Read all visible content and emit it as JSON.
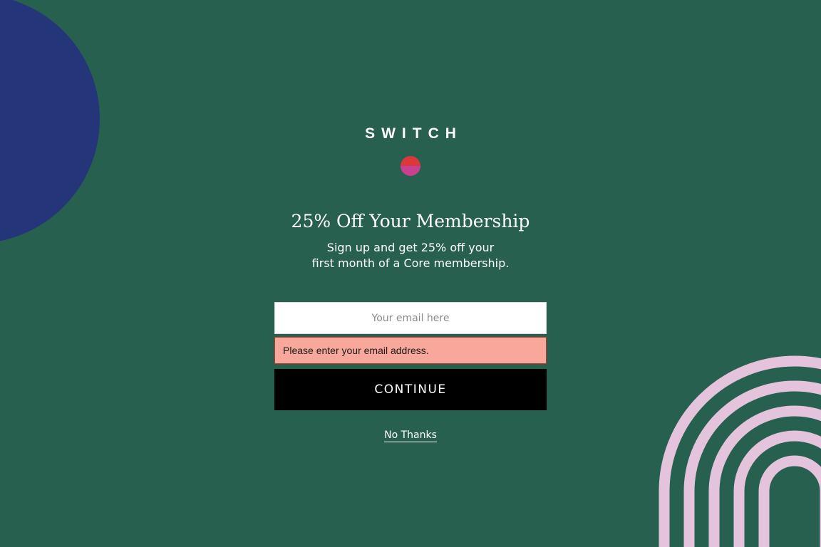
{
  "colors": {
    "background": "#27604f",
    "deco_circle": "#25357a",
    "deco_rings": "#e4c4dc",
    "text_light": "#ffffff",
    "logo_mark_top": "#d9383c",
    "logo_mark_bottom": "#c9408f",
    "error_background": "#f8a89a",
    "button_background": "#000000"
  },
  "brand": {
    "logo_text": "SWITCH"
  },
  "offer": {
    "headline": "25% Off Your Membership",
    "subtext_line1": "Sign up and get 25% off your",
    "subtext_line2": "first month of a Core membership."
  },
  "form": {
    "email_placeholder": "Your email here",
    "email_value": "",
    "error_message": "Please enter your email address.",
    "submit_label": "CONTINUE",
    "dismiss_label": "No Thanks"
  },
  "icons": {
    "logo_mark": "half-circle-dot-icon",
    "decor_left": "blue-circle-shape",
    "decor_right": "pink-concentric-arches"
  }
}
